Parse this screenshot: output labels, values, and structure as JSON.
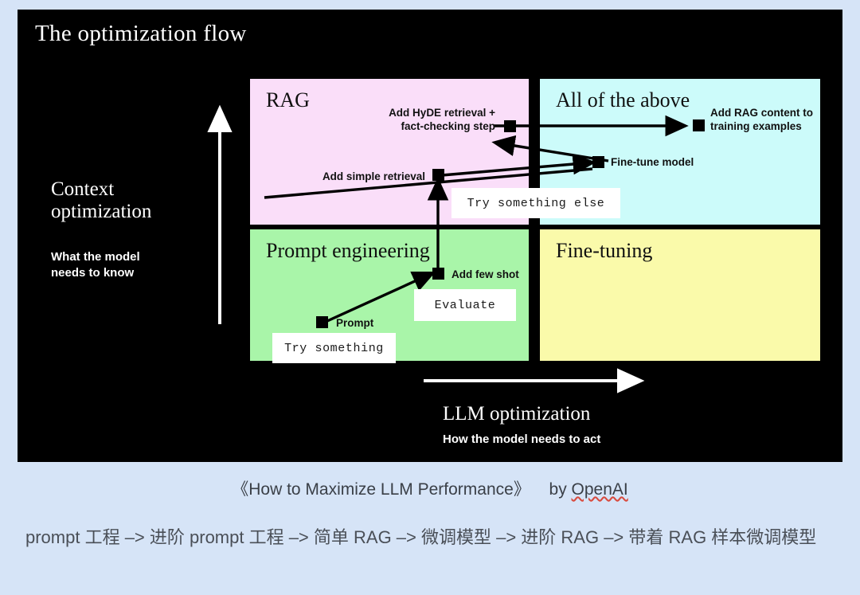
{
  "page": {
    "background_color": "#d6e4f7"
  },
  "diagram": {
    "title": "The optimization flow",
    "background_color": "#000000",
    "quadrants": [
      {
        "id": "rag",
        "label": "RAG",
        "color": "#fadef9"
      },
      {
        "id": "all-of-the-above",
        "label": "All of the above",
        "color": "#ccfbfa"
      },
      {
        "id": "prompt-engineering",
        "label": "Prompt engineering",
        "color": "#a9f5a9"
      },
      {
        "id": "fine-tuning",
        "label": "Fine-tuning",
        "color": "#fafaaa"
      }
    ],
    "nodes": [
      {
        "id": "add-hyde-retrieval",
        "label": "Add HyDE retrieval +\nfact-checking step",
        "quadrant": "rag"
      },
      {
        "id": "add-simple-retrieval",
        "label": "Add simple retrieval",
        "quadrant": "rag"
      },
      {
        "id": "add-rag-content",
        "label": "Add RAG content to\ntraining examples",
        "quadrant": "all-of-the-above"
      },
      {
        "id": "fine-tune-model",
        "label": "Fine-tune model",
        "quadrant": "all-of-the-above"
      },
      {
        "id": "add-few-shot",
        "label": "Add few shot",
        "quadrant": "prompt-engineering"
      },
      {
        "id": "prompt",
        "label": "Prompt",
        "quadrant": "prompt-engineering"
      }
    ],
    "callouts": [
      {
        "id": "try-something",
        "label": "Try something"
      },
      {
        "id": "evaluate",
        "label": "Evaluate"
      },
      {
        "id": "try-something-else",
        "label": "Try something else"
      }
    ],
    "y_axis": {
      "title_line1": "Context",
      "title_line2": "optimization",
      "subtitle_line1": "What the model",
      "subtitle_line2": "needs to know"
    },
    "x_axis": {
      "title": "LLM optimization",
      "subtitle": "How the model needs to act"
    }
  },
  "caption": {
    "title": "《How to Maximize LLM Performance》",
    "by": "by",
    "source": "OpenAI"
  },
  "summary": {
    "text": "prompt 工程 –> 进阶 prompt 工程 –> 简单 RAG –> 微调模型 –> 进阶 RAG –> 带着 RAG 样本微调模型"
  }
}
